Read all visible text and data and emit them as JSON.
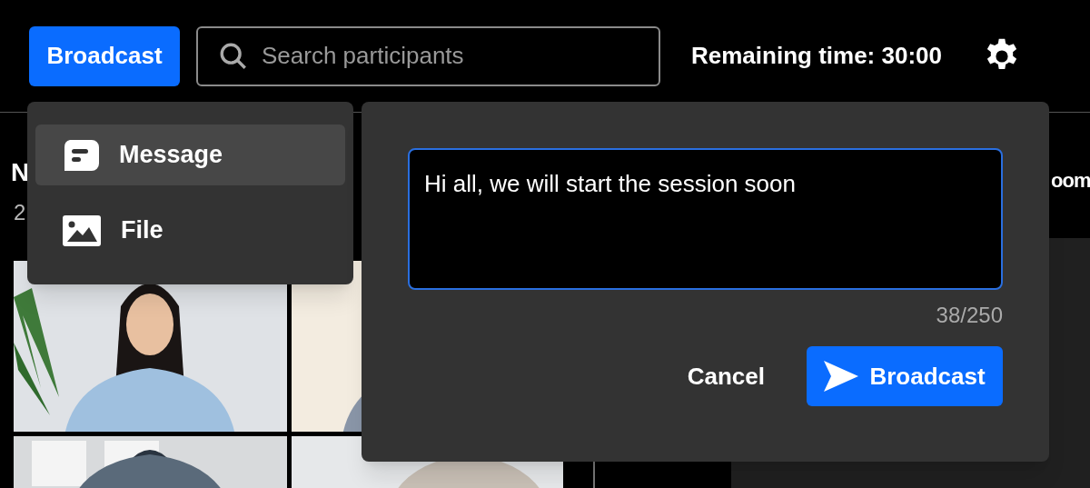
{
  "top_bar": {
    "broadcast_button": "Broadcast",
    "search": {
      "placeholder": "Search participants"
    },
    "remaining_time": "Remaining time: 30:00"
  },
  "background": {
    "title_fragment": "N",
    "subtitle_fragment": "2",
    "right_fragment": "oom"
  },
  "broadcast_menu": {
    "items": [
      {
        "kind": "message",
        "label": "Message",
        "selected": true
      },
      {
        "kind": "file",
        "label": "File",
        "selected": false
      }
    ]
  },
  "broadcast_dialog": {
    "message": "Hi all, we will start the session soon",
    "counter": "38/250",
    "buttons": [
      {
        "kind": "cancel",
        "label": "Cancel"
      },
      {
        "kind": "broadcast",
        "label": "Broadcast"
      }
    ]
  }
}
